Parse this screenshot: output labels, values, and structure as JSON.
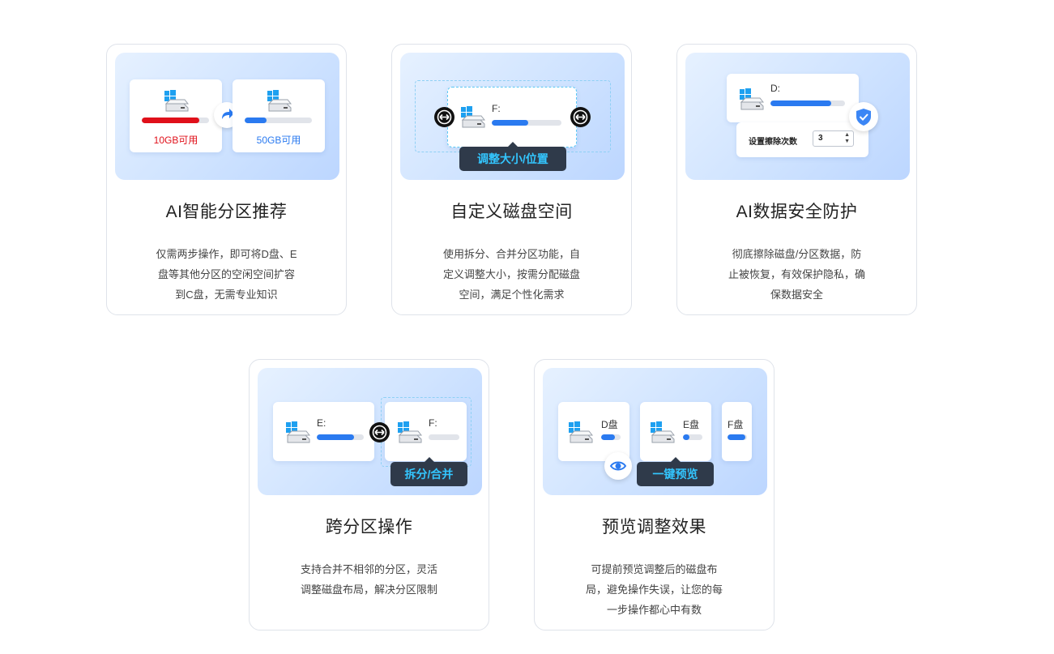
{
  "cards": [
    {
      "title": "AI智能分区推荐",
      "desc": [
        "仅需两步操作，即可将D盘、E",
        "盘等其他分区的空闲空间扩容",
        "到C盘，无需专业知识"
      ],
      "illus": {
        "left_disk_avail": "10GB可用",
        "right_disk_avail": "50GB可用",
        "left_fill": 0.85,
        "right_fill": 0.33,
        "left_color": "#e0101a",
        "right_color": "#2a7af0"
      }
    },
    {
      "title": "自定义磁盘空间",
      "desc": [
        "使用拆分、合并分区功能，自",
        "定义调整大小，按需分配磁盘",
        "空间，满足个性化需求"
      ],
      "illus": {
        "drive_label": "F:",
        "fill": 0.52,
        "tag": "调整大小/位置"
      }
    },
    {
      "title": "AI数据安全防护",
      "desc": [
        "彻底擦除磁盘/分区数据，防",
        "止被恢复，有效保护隐私，确",
        "保数据安全"
      ],
      "illus": {
        "drive_label": "D:",
        "fill": 0.82,
        "wipe_label": "设置擦除次数",
        "wipe_value": "3"
      }
    },
    {
      "title": "跨分区操作",
      "desc": [
        "支持合并不相邻的分区，灵活",
        "调整磁盘布局，解决分区限制"
      ],
      "illus": {
        "left_label": "E:",
        "left_fill": 0.8,
        "right_label": "F:",
        "right_fill": 0.0,
        "tag": "拆分/合并"
      }
    },
    {
      "title": "预览调整效果",
      "desc": [
        "可提前预览调整后的磁盘布",
        "局，避免操作失误，让您的每",
        "一步操作都心中有数"
      ],
      "illus": {
        "d_label": "D盘",
        "d_fill": 0.7,
        "e_label": "E盘",
        "e_fill": 0.35,
        "f_label": "F盘",
        "f_fill": 0.9,
        "tag": "一键预览"
      }
    }
  ],
  "colors": {
    "accent_blue": "#2a7af0",
    "cyan": "#33c6ff",
    "red": "#e0101a"
  }
}
